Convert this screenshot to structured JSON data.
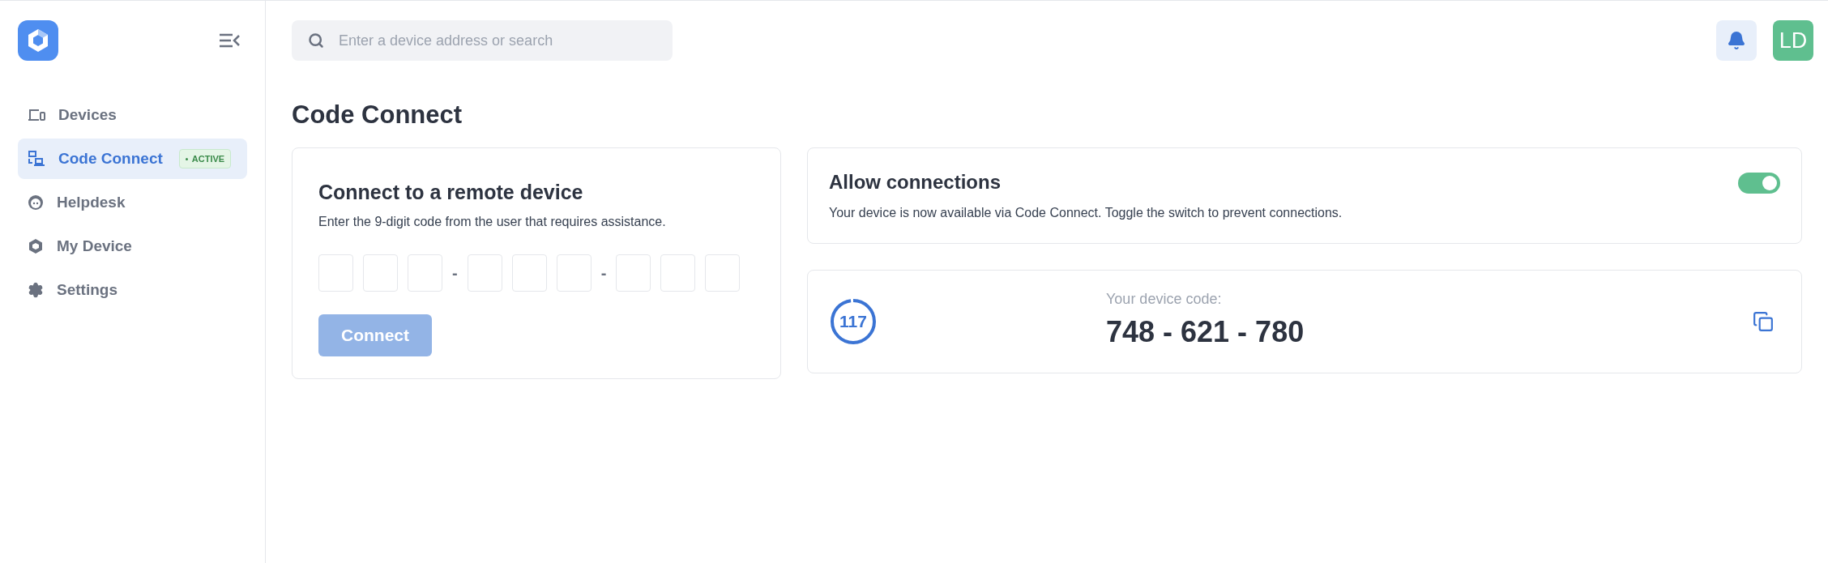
{
  "sidebar": {
    "items": [
      {
        "label": "Devices",
        "kind": "devices",
        "selected": false
      },
      {
        "label": "Code Connect",
        "kind": "code",
        "selected": true,
        "badge": "ACTIVE"
      },
      {
        "label": "Helpdesk",
        "kind": "helpdesk",
        "selected": false
      },
      {
        "label": "My Device",
        "kind": "mydevice",
        "selected": false
      },
      {
        "label": "Settings",
        "kind": "settings",
        "selected": false
      }
    ]
  },
  "search": {
    "placeholder": "Enter a device address or search"
  },
  "user": {
    "initials": "LD"
  },
  "page_title": "Code Connect",
  "connect_card": {
    "title": "Connect to a remote device",
    "description": "Enter the 9-digit code from the user that requires assistance.",
    "separators": [
      "-",
      "-"
    ],
    "button": {
      "label": "Connect",
      "disabled": true
    }
  },
  "allow_card": {
    "title": "Allow connections",
    "description": "Your device is now available via Code Connect. Toggle the switch to prevent connections.",
    "on": true
  },
  "code_card": {
    "timer": "117",
    "label": "Your device code:",
    "code": "748 - 621 - 780"
  }
}
